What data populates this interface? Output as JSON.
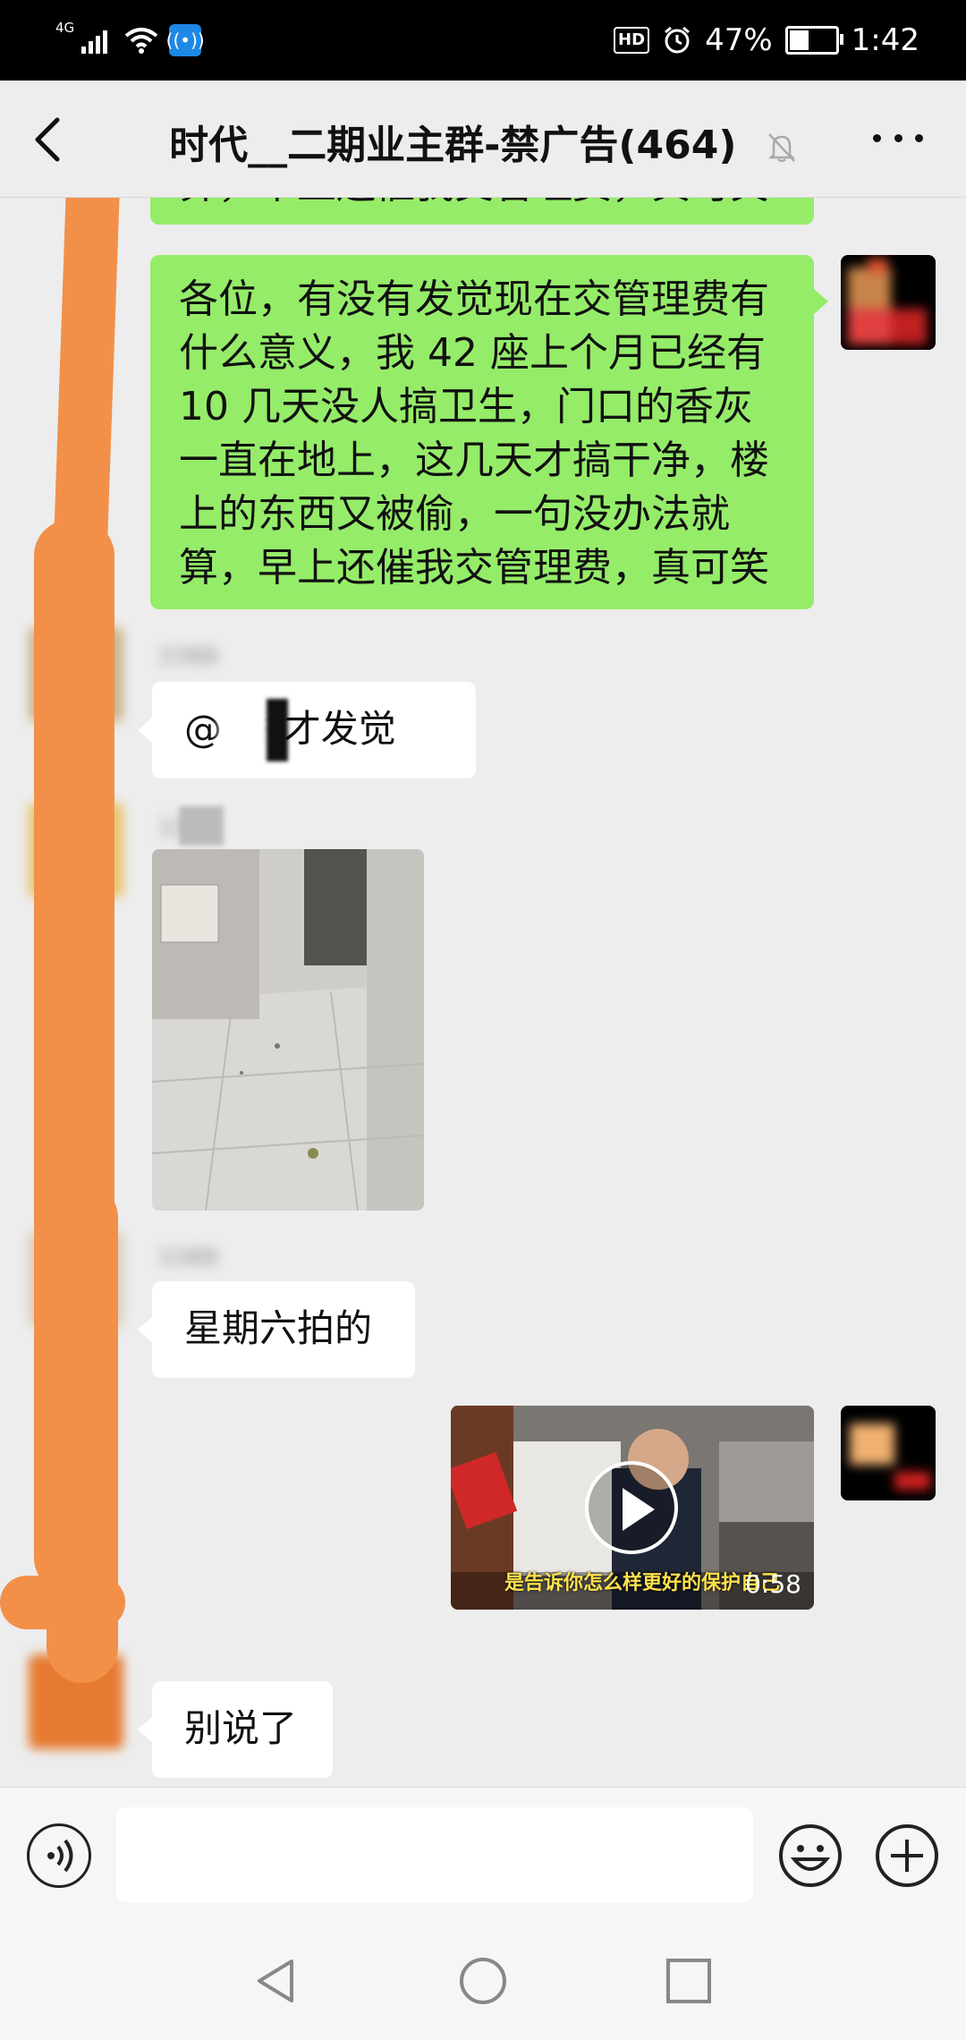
{
  "status_bar": {
    "network": "4G",
    "hd": "HD",
    "battery_percent": "47%",
    "battery_level": 0.47,
    "time": "1:42"
  },
  "header": {
    "title": "时代__二期业主群-禁广告(464)",
    "back_icon": "chevron-left-icon",
    "mute_icon": "bell-off-icon",
    "more_icon": "more-icon"
  },
  "messages": [
    {
      "id": "m0",
      "side": "right",
      "type": "text",
      "text": "算，早上还催我交管理费，真可笑"
    },
    {
      "id": "m1",
      "side": "right",
      "type": "text",
      "lines": [
        "各位，有没有发觉现在交管理费有",
        "什么意义，我 42 座上个月已经有",
        "10 几天没人搞卫生，门口的香灰",
        "一直在地上，这几天才搞干净，楼",
        "上的东西又被偷，一句没办法就",
        "算，早上还催我交管理费，真可笑"
      ]
    },
    {
      "id": "m2",
      "side": "left",
      "type": "text",
      "sender": "33BB",
      "text": "@    香  才发觉"
    },
    {
      "id": "m3",
      "side": "left",
      "type": "image",
      "sender": "33"
    },
    {
      "id": "m4",
      "side": "left",
      "type": "text",
      "sender": "33BB",
      "text": "星期六拍的"
    },
    {
      "id": "m5",
      "side": "right",
      "type": "video",
      "duration": "0:58",
      "caption": "是告诉你怎么样更好的保护自己"
    },
    {
      "id": "m6",
      "side": "left",
      "type": "text",
      "text": "别说了"
    }
  ],
  "input_bar": {
    "voice_icon": "voice-icon",
    "input_value": "",
    "emoji_icon": "emoji-icon",
    "plus_icon": "plus-icon"
  },
  "nav_bar": {
    "back_icon": "triangle-back-icon",
    "home_icon": "circle-home-icon",
    "recent_icon": "square-recent-icon"
  },
  "colors": {
    "green_bubble": "#95ec69",
    "background": "#ededed",
    "redaction": "#f2904a"
  }
}
